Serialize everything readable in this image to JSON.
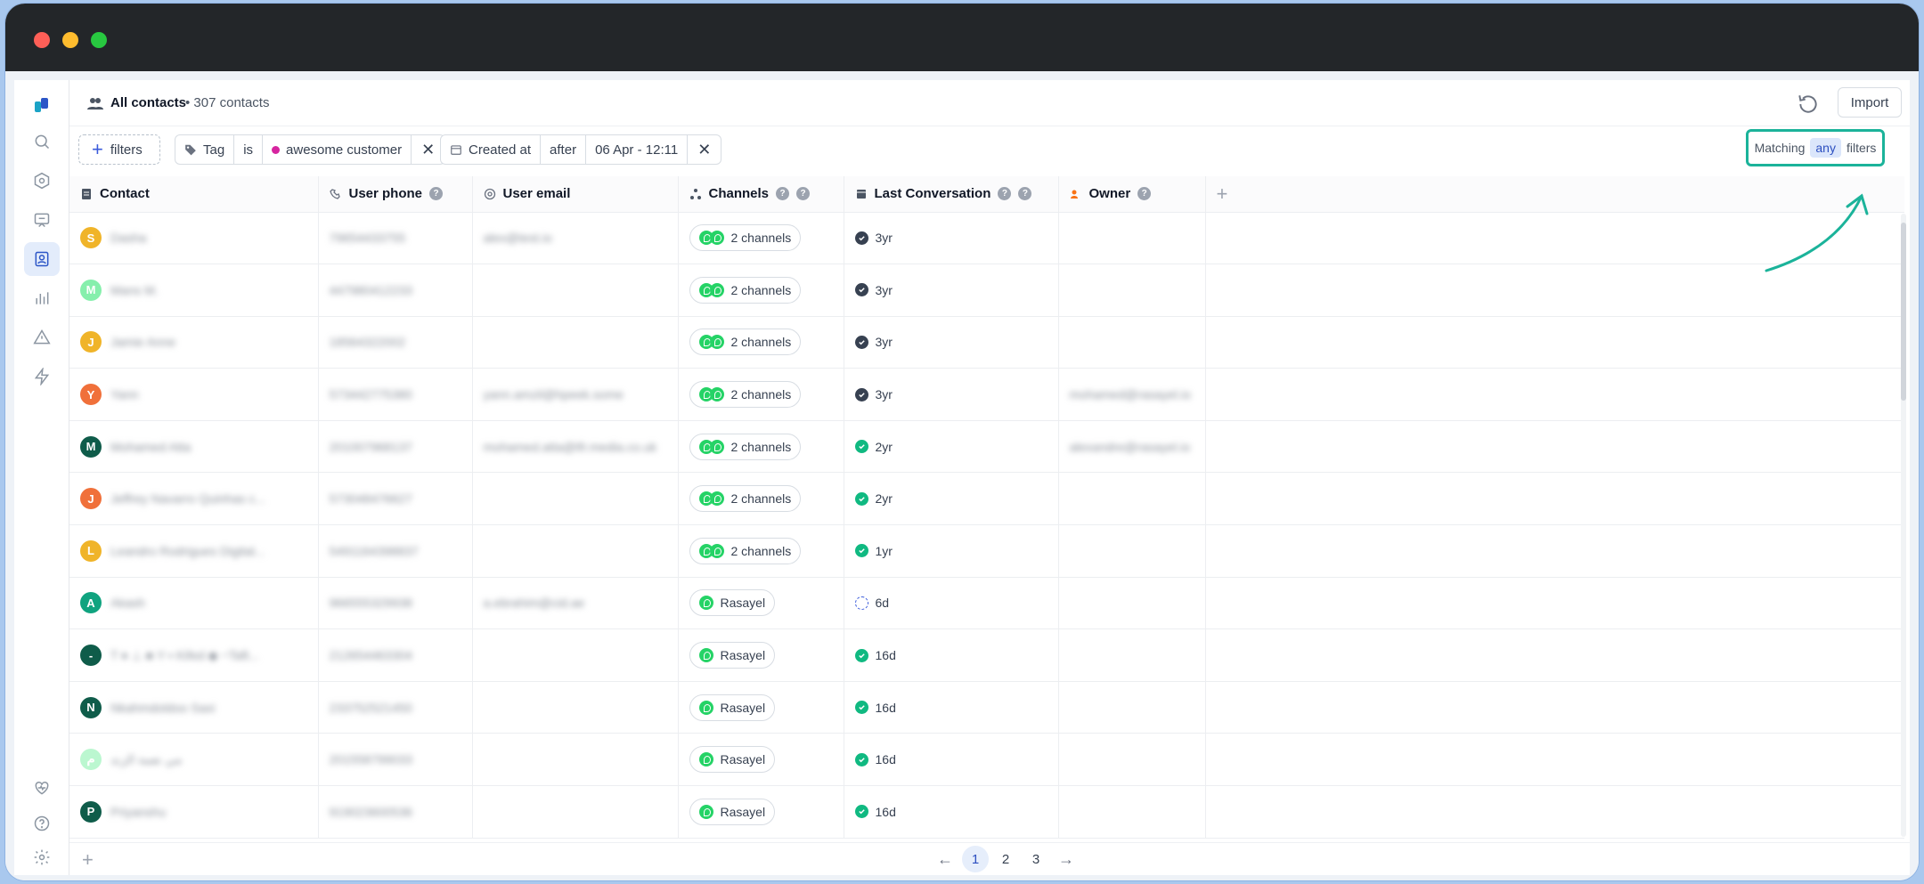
{
  "header": {
    "title": "All contacts",
    "count": "• 307 contacts",
    "import_label": "Import"
  },
  "filters": {
    "add_label": "filters",
    "chip1": {
      "field": "Tag",
      "op": "is",
      "value": "awesome customer"
    },
    "chip2": {
      "field": "Created at",
      "op": "after",
      "value": "06 Apr - 12:11"
    },
    "matching": {
      "prefix": "Matching",
      "mode": "any",
      "suffix": "filters"
    }
  },
  "columns": {
    "contact": "Contact",
    "phone": "User phone",
    "email": "User email",
    "channels": "Channels",
    "last_conversation": "Last Conversation",
    "owner": "Owner"
  },
  "rows": [
    {
      "initial": "S",
      "avatar_color": "#f0b429",
      "name": "Dasha",
      "phone": "79654433755",
      "email": "alex@test.io",
      "channels": "2 channels",
      "multi": true,
      "status": "closed",
      "last": "3yr",
      "owner": ""
    },
    {
      "initial": "M",
      "avatar_color": "#86efac",
      "name": "Mans M.",
      "phone": "447980412233",
      "email": "",
      "channels": "2 channels",
      "multi": true,
      "status": "closed",
      "last": "3yr",
      "owner": ""
    },
    {
      "initial": "J",
      "avatar_color": "#f0b429",
      "name": "Jamie Anne",
      "phone": "18564322002",
      "email": "",
      "channels": "2 channels",
      "multi": true,
      "status": "closed",
      "last": "3yr",
      "owner": ""
    },
    {
      "initial": "Y",
      "avatar_color": "#f0703a",
      "name": "Yann",
      "phone": "573442775380",
      "email": "yann.amzil@hpeek.some",
      "channels": "2 channels",
      "multi": true,
      "status": "closed",
      "last": "3yr",
      "owner": "mohamed@rasayel.io"
    },
    {
      "initial": "M",
      "avatar_color": "#0f5c4a",
      "name": "Mohamed Atta",
      "phone": "201007968137",
      "email": "mohamed.atta@tfr.media.co.uk",
      "channels": "2 channels",
      "multi": true,
      "status": "resolved",
      "last": "2yr",
      "owner": "alexandre@rasayel.io"
    },
    {
      "initial": "J",
      "avatar_color": "#f0703a",
      "name": "Jeffrey Navarro Quinhas c...",
      "phone": "573048476627",
      "email": "",
      "channels": "2 channels",
      "multi": true,
      "status": "resolved",
      "last": "2yr",
      "owner": ""
    },
    {
      "initial": "L",
      "avatar_color": "#f0b429",
      "name": "Leandro Rodrigues Digital...",
      "phone": "5491164398837",
      "email": "",
      "channels": "2 channels",
      "multi": true,
      "status": "resolved",
      "last": "1yr",
      "owner": ""
    },
    {
      "initial": "A",
      "avatar_color": "#10a37f",
      "name": "Akash",
      "phone": "966555329938",
      "email": "a.ebrahim@cid.ae",
      "channels": "Rasayel",
      "multi": false,
      "status": "open",
      "last": "6d",
      "owner": ""
    },
    {
      "initial": "-",
      "avatar_color": "#0f5c4a",
      "name": "T ♦ ⊥ ♣ Y ▪ Kifed ◆ ~Taft...",
      "phone": "212654463304",
      "email": "",
      "channels": "Rasayel",
      "multi": false,
      "status": "resolved",
      "last": "16d",
      "owner": ""
    },
    {
      "initial": "N",
      "avatar_color": "#0f5c4a",
      "name": "Nkahmdoldoo Saxi",
      "phone": "233752521450",
      "email": "",
      "channels": "Rasayel",
      "multi": false,
      "status": "resolved",
      "last": "16d",
      "owner": ""
    },
    {
      "initial": "م",
      "avatar_color": "#bbf7d0",
      "name": "مي نعمة الزند",
      "phone": "201558799033",
      "email": "",
      "channels": "Rasayel",
      "multi": false,
      "status": "resolved",
      "last": "16d",
      "owner": ""
    },
    {
      "initial": "P",
      "avatar_color": "#0f5c4a",
      "name": "Priyanshu",
      "phone": "919023600536",
      "email": "",
      "channels": "Rasayel",
      "multi": false,
      "status": "resolved",
      "last": "16d",
      "owner": ""
    }
  ],
  "pagination": {
    "pages": [
      "1",
      "2",
      "3"
    ],
    "prev": "←",
    "next": "→"
  }
}
